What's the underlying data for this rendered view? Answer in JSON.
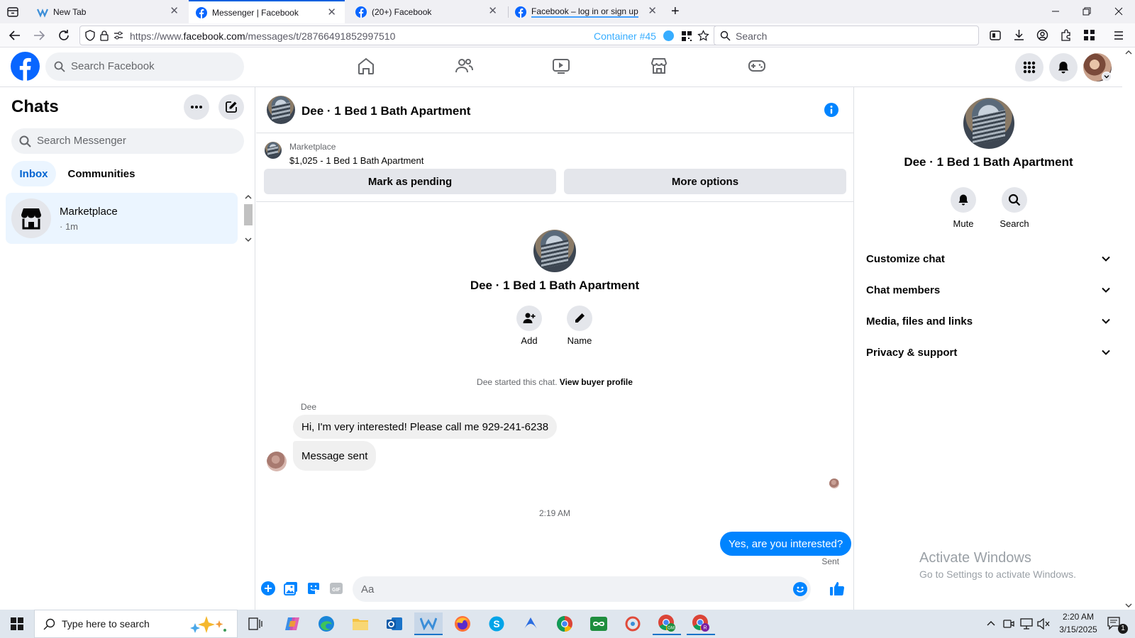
{
  "browser": {
    "tabs": [
      {
        "title": "New Tab",
        "active": false
      },
      {
        "title": "Messenger | Facebook",
        "active": true
      },
      {
        "title": "(20+) Facebook",
        "active": false
      },
      {
        "title": "Facebook – log in or sign up",
        "active": false
      }
    ],
    "url_prefix": "https://www.",
    "url_domain": "facebook.com",
    "url_path": "/messages/t/28766491852997510",
    "container_label": "Container #45",
    "search_placeholder": "Search"
  },
  "fb_header": {
    "search_placeholder": "Search Facebook"
  },
  "chats": {
    "title": "Chats",
    "search_placeholder": "Search Messenger",
    "filters": [
      "Inbox",
      "Communities"
    ],
    "active_filter": "Inbox",
    "items": [
      {
        "name": "Marketplace",
        "meta": "· 1m"
      }
    ]
  },
  "conversation": {
    "title": "Dee · 1 Bed 1 Bath Apartment",
    "listing_source": "Marketplace",
    "listing_summary": "$1,025 - 1 Bed 1 Bath Apartment",
    "mark_pending_label": "Mark as pending",
    "more_options_label": "More options",
    "profile_name": "Dee · 1 Bed 1 Bath Apartment",
    "add_label": "Add",
    "name_label": "Name",
    "started_text": "Dee started this chat.",
    "view_buyer_label": "View buyer profile",
    "sender_name": "Dee",
    "messages_in": [
      "Hi, I'm very interested! Please call me 929-241-6238",
      "Message sent"
    ],
    "timestamp": "2:19 AM",
    "message_out": "Yes, are you interested?",
    "out_status": "Sent",
    "composer_placeholder": "Aa"
  },
  "details": {
    "title": "Dee · 1 Bed 1 Bath Apartment",
    "mute_label": "Mute",
    "search_label": "Search",
    "sections": [
      "Customize chat",
      "Chat members",
      "Media, files and links",
      "Privacy & support"
    ]
  },
  "watermark": {
    "line1": "Activate Windows",
    "line2": "Go to Settings to activate Windows."
  },
  "taskbar": {
    "search_placeholder": "Type here to search",
    "time": "2:20 AM",
    "date": "3/15/2025",
    "notification_count": "1"
  },
  "colors": {
    "facebook_blue": "#0866ff",
    "messenger_blue": "#0084ff",
    "selected_chat_bg": "#ebf5ff"
  }
}
